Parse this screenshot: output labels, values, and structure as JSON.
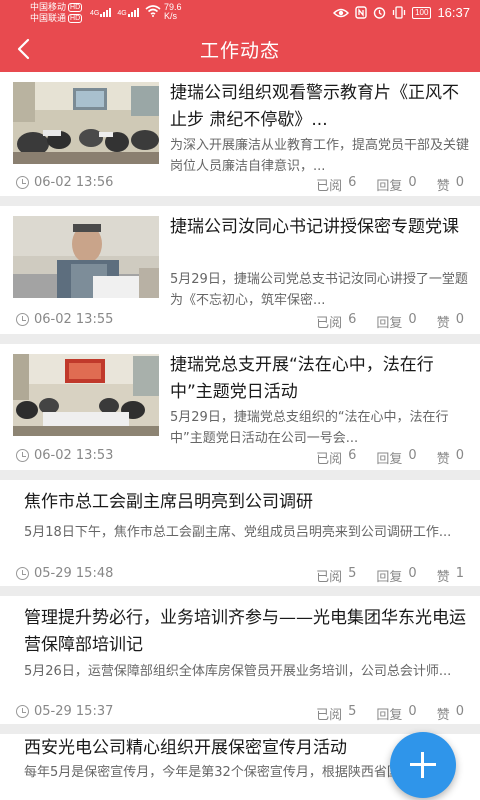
{
  "status_bar": {
    "carrier1": "中国移动",
    "carrier2": "中国联通",
    "hd_badge": "HD",
    "net1": "4G",
    "net2": "4G",
    "speed_value": "79.6",
    "speed_unit": "K/s",
    "battery": "100",
    "time": "16:37"
  },
  "header": {
    "title": "工作动态"
  },
  "articles": [
    {
      "title": "捷瑞公司组织观看警示教育片《正风不止步 肃纪不停歇》...",
      "summary": "为深入开展廉洁从业教育工作，提高党员干部及关键岗位人员廉洁自律意识，...",
      "time": "06-02 13:56",
      "read_label": "已阅",
      "read": "6",
      "reply_label": "回复",
      "reply": "0",
      "like_label": "赞",
      "like": "0"
    },
    {
      "title": "捷瑞公司汝同心书记讲授保密专题党课",
      "summary": "5月29日，捷瑞公司党总支书记汝同心讲授了一堂题为《不忘初心，筑牢保密...",
      "time": "06-02 13:55",
      "read_label": "已阅",
      "read": "6",
      "reply_label": "回复",
      "reply": "0",
      "like_label": "赞",
      "like": "0"
    },
    {
      "title": "捷瑞党总支开展“法在心中，法在行中”主题党日活动",
      "summary": "5月29日，捷瑞党总支组织的“法在心中，法在行中”主题党日活动在公司一号会...",
      "time": "06-02 13:53",
      "read_label": "已阅",
      "read": "6",
      "reply_label": "回复",
      "reply": "0",
      "like_label": "赞",
      "like": "0"
    },
    {
      "title": "焦作市总工会副主席吕明亮到公司调研",
      "summary": "5月18日下午，焦作市总工会副主席、党组成员吕明亮来到公司调研工作...",
      "time": "05-29 15:48",
      "read_label": "已阅",
      "read": "5",
      "reply_label": "回复",
      "reply": "0",
      "like_label": "赞",
      "like": "1"
    },
    {
      "title": "管理提升势必行，业务培训齐参与——光电集团华东光电运营保障部培训记",
      "summary": "5月26日，运营保障部组织全体库房保管员开展业务培训，公司总会计师...",
      "time": "05-29 15:37",
      "read_label": "已阅",
      "read": "5",
      "reply_label": "回复",
      "reply": "0",
      "like_label": "赞",
      "like": "0"
    },
    {
      "title": "西安光电公司精心组织开展保密宣传月活动",
      "summary": "每年5月是保密宣传月，今年是第32个保密宣传月，根据陕西省国防科...",
      "time": "",
      "read_label": "",
      "read": "",
      "reply_label": "",
      "reply": "",
      "like_label": "",
      "like": ""
    }
  ],
  "icons": {
    "back": "chevron-left-icon",
    "clock": "clock-icon",
    "fab": "plus-icon"
  },
  "colors": {
    "header": "#e84a4f",
    "fab": "#2f95ea",
    "background": "#ececec"
  }
}
